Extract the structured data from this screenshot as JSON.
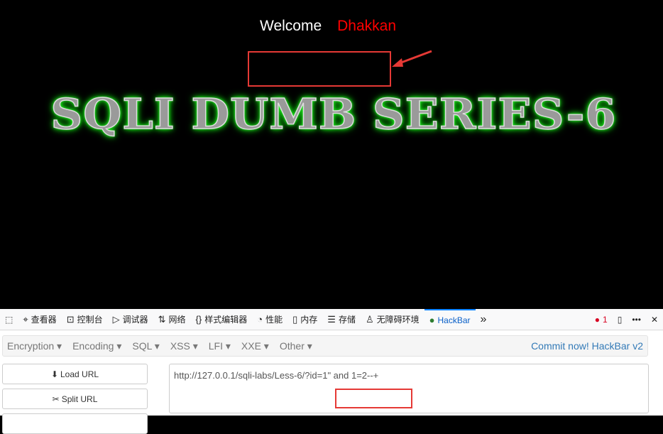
{
  "page": {
    "welcome": "Welcome",
    "user": "Dhakkan",
    "banner": "SQLI DUMB SERIES-6"
  },
  "devtools": {
    "tabs": [
      {
        "icon": "inspector-icon",
        "label": "查看器"
      },
      {
        "icon": "console-icon",
        "label": "控制台"
      },
      {
        "icon": "debugger-icon",
        "label": "调试器"
      },
      {
        "icon": "network-icon",
        "label": "网络"
      },
      {
        "icon": "style-editor-icon",
        "label": "样式编辑器"
      },
      {
        "icon": "performance-icon",
        "label": "性能"
      },
      {
        "icon": "memory-icon",
        "label": "内存"
      },
      {
        "icon": "storage-icon",
        "label": "存储"
      },
      {
        "icon": "accessibility-icon",
        "label": "无障碍环境"
      },
      {
        "icon": "hackbar-icon",
        "label": "HackBar",
        "active": true
      }
    ],
    "error_count": "1"
  },
  "hackbar": {
    "menus": [
      "Encryption",
      "Encoding",
      "SQL",
      "XSS",
      "LFI",
      "XXE",
      "Other"
    ],
    "commit": "Commit now! HackBar v2",
    "load_url": "Load URL",
    "split_url": "Split URL",
    "url_value": "http://127.0.0.1/sqli-labs/Less-6/?id=1\" and 1=2--+"
  },
  "colors": {
    "highlight": "#e53935",
    "accent": "#0a84ff",
    "title_glow": "#22ff22"
  }
}
